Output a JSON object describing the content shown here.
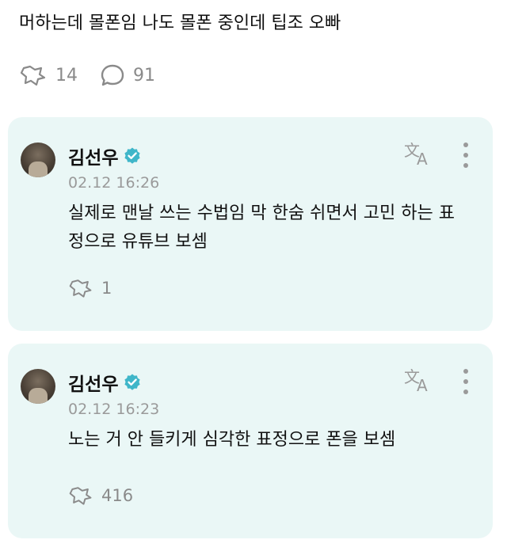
{
  "post": {
    "text": "머하는데 몰폰임 나도 몰폰 중인데 팁조 오빠",
    "repost_count": "14",
    "comment_count": "91"
  },
  "replies": [
    {
      "author": "김선우",
      "timestamp": "02.12 16:26",
      "text": "실제로 맨날 쓰는 수법임 막 한숨 쉬면서 고민 하는 표정으로 유튜브 보셈",
      "repost_count": "1"
    },
    {
      "author": "김선우",
      "timestamp": "02.12 16:23",
      "text": "노는 거 안 들키게 심각한 표정으로 폰을 보셈",
      "repost_count": "416"
    }
  ],
  "icons": {
    "repost": "repost-icon",
    "comment": "comment-bubble-icon",
    "verified": "verified-badge-icon",
    "translate": "translate-icon",
    "more": "more-vertical-icon"
  },
  "colors": {
    "card_background": "#eaf7f6",
    "verified_badge": "#3fb6c9",
    "muted_text": "#8a8a8a"
  }
}
